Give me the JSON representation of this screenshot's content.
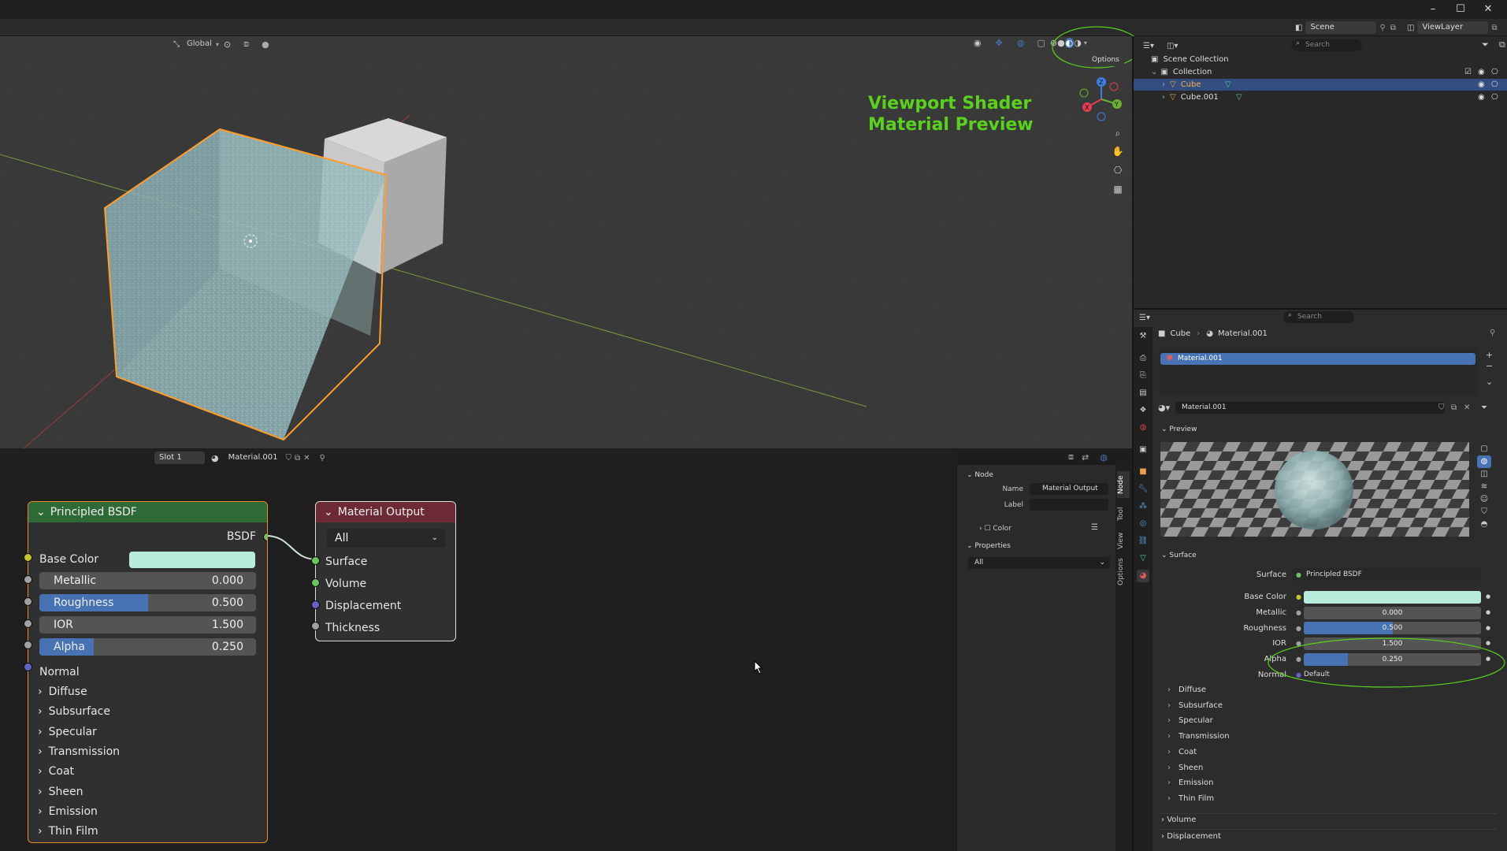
{
  "topbar": {
    "scene": "Scene",
    "viewlayer": "ViewLayer"
  },
  "window_controls": {
    "minimize": "–",
    "maximize": "☐",
    "close": "✕"
  },
  "viewport": {
    "orientation": "Global",
    "options_label": "Options",
    "annotation_line1": "Viewport Shader",
    "annotation_line2": "Material Preview",
    "gizmo": {
      "z": "Z",
      "y": "Y",
      "x": "X"
    }
  },
  "node_editor": {
    "slot": "Slot 1",
    "material": "Material.001",
    "principled": {
      "title": "Principled BSDF",
      "output": "BSDF",
      "base_color_label": "Base Color",
      "base_color": "#b9ecdc",
      "fields": [
        {
          "label": "Metallic",
          "value": "0.000",
          "fill": 0
        },
        {
          "label": "Roughness",
          "value": "0.500",
          "fill": 0.5
        },
        {
          "label": "IOR",
          "value": "1.500",
          "fill": 0
        },
        {
          "label": "Alpha",
          "value": "0.250",
          "fill": 0.25
        }
      ],
      "normal_label": "Normal",
      "subpanels": [
        "Diffuse",
        "Subsurface",
        "Specular",
        "Transmission",
        "Coat",
        "Sheen",
        "Emission",
        "Thin Film"
      ]
    },
    "output_node": {
      "title": "Material Output",
      "target": "All",
      "inputs": [
        "Surface",
        "Volume",
        "Displacement",
        "Thickness"
      ]
    },
    "sidebar": {
      "node_header": "Node",
      "name_label": "Name",
      "name_value": "Material Output",
      "label_label": "Label",
      "color_label": "Color",
      "properties_header": "Properties",
      "properties_value": "All",
      "tabs": [
        "Node",
        "Tool",
        "View",
        "Options"
      ]
    }
  },
  "outliner": {
    "search_placeholder": "Search",
    "items": [
      {
        "label": "Scene Collection"
      },
      {
        "label": "Collection"
      },
      {
        "label": "Cube"
      },
      {
        "label": "Cube.001"
      }
    ]
  },
  "properties": {
    "search_placeholder": "Search",
    "breadcrumb_object": "Cube",
    "breadcrumb_material": "Material.001",
    "slot_item": "Material.001",
    "material_name": "Material.001",
    "preview_label": "Preview",
    "surface_label": "Surface",
    "surface_row_label": "Surface",
    "surface_value": "Principled BSDF",
    "base_color_label": "Base Color",
    "base_color": "#b9ecdc",
    "fields": [
      {
        "label": "Metallic",
        "value": "0.000",
        "fill": 0
      },
      {
        "label": "Roughness",
        "value": "0.500",
        "fill": 0.5
      },
      {
        "label": "IOR",
        "value": "1.500",
        "fill": 0
      },
      {
        "label": "Alpha",
        "value": "0.250",
        "fill": 0.25
      }
    ],
    "normal_label": "Normal",
    "normal_value": "Default",
    "subpanels": [
      "Diffuse",
      "Subsurface",
      "Specular",
      "Transmission",
      "Coat",
      "Sheen",
      "Emission",
      "Thin Film"
    ],
    "volume_label": "Volume",
    "displacement_label": "Displacement"
  },
  "colors": {
    "accent": "#4772b3",
    "annotation": "#5ad21d",
    "selection": "#ff9d2e"
  }
}
